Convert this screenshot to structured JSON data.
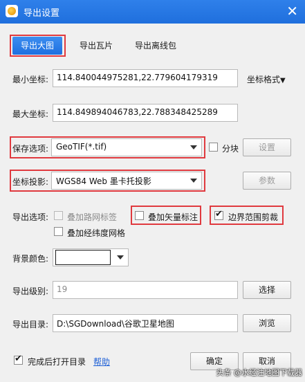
{
  "window": {
    "title": "导出设置"
  },
  "tabs": [
    {
      "label": "导出大图"
    },
    {
      "label": "导出瓦片"
    },
    {
      "label": "导出离线包"
    }
  ],
  "min_coord": {
    "label": "最小坐标:",
    "value": "114.840044975281,22.779604179319"
  },
  "coord_format": {
    "label": "坐标格式"
  },
  "max_coord": {
    "label": "最大坐标:",
    "value": "114.849894046783,22.788348425289"
  },
  "save_option": {
    "label": "保存选项:",
    "value": "GeoTIF(*.tif)",
    "split_label": "分块",
    "settings_label": "设置"
  },
  "projection": {
    "label": "坐标投影:",
    "value": "WGS84 Web 墨卡托投影",
    "params_label": "参数"
  },
  "export_options": {
    "label": "导出选项:",
    "road_labels": "叠加路网标签",
    "vector_labels": "叠加矢量标注",
    "boundary_clip": "边界范围剪裁",
    "graticule": "叠加经纬度网格"
  },
  "bg_color": {
    "label": "背景颜色:",
    "swatch": "#ffffff"
  },
  "export_level": {
    "label": "导出级别:",
    "value": "19",
    "select_label": "选择"
  },
  "export_dir": {
    "label": "导出目录:",
    "value": "D:\\SGDownload\\谷歌卫星地图",
    "browse_label": "浏览"
  },
  "footer": {
    "open_after": "完成后打开目录",
    "help": "帮助",
    "ok": "确定",
    "cancel": "取消"
  },
  "watermark": "头条 @水经注地图下载器",
  "colors": {
    "titlebar": "#2a7ae6",
    "highlight": "#e0393e",
    "accent": "#1d6fe0"
  }
}
